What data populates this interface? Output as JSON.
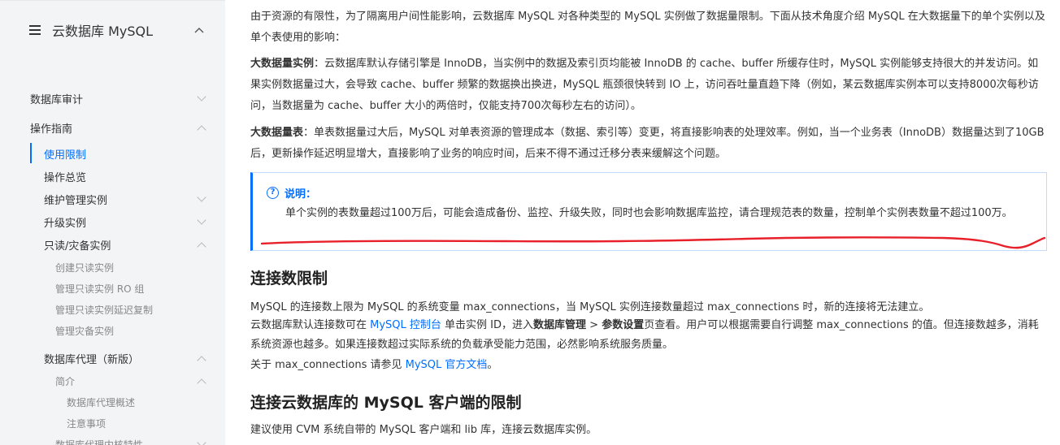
{
  "sidebar": {
    "title": "云数据库 MySQL",
    "items": [
      {
        "label": "数据库审计",
        "arrow": "down"
      },
      {
        "label": "操作指南",
        "arrow": "up"
      },
      {
        "label": "使用限制"
      },
      {
        "label": "操作总览"
      },
      {
        "label": "维护管理实例",
        "arrow": "down"
      },
      {
        "label": "升级实例",
        "arrow": "down"
      },
      {
        "label": "只读/灾备实例",
        "arrow": "up"
      },
      {
        "label": "创建只读实例"
      },
      {
        "label": "管理只读实例 RO 组"
      },
      {
        "label": "管理只读实例延迟复制"
      },
      {
        "label": "管理灾备实例"
      },
      {
        "label": "数据库代理（新版）",
        "arrow": "up"
      },
      {
        "label": "简介",
        "arrow": "up"
      },
      {
        "label": "数据库代理概述"
      },
      {
        "label": "注意事项"
      },
      {
        "label": "数据库代理内核特性",
        "arrow": "down"
      }
    ]
  },
  "content": {
    "intro": "由于资源的有限性，为了隔离用户间性能影响，云数据库 MySQL 对各种类型的 MySQL 实例做了数据量限制。下面从技术角度介绍 MySQL 在大数据量下的单个实例以及单个表使用的影响：",
    "big_instance_label": "大数据量实例",
    "big_instance_text": "：云数据库默认存储引擎是 InnoDB，当实例中的数据及索引页均能被 InnoDB 的 cache、buffer 所缓存住时，MySQL 实例能够支持很大的并发访问。如果实例数据量过大，会导致 cache、buffer 频繁的数据换出换进，MySQL 瓶颈很快转到 IO 上，访问吞吐量直趋下降（例如，某云数据库实例本可以支持8000次每秒访问，当数据量为 cache、buffer 大小的两倍时，仅能支持700次每秒左右的访问）。",
    "big_table_label": "大数据量表",
    "big_table_text": "：单表数据量过大后，MySQL 对单表资源的管理成本（数据、索引等）变更，将直接影响表的处理效率。例如，当一个业务表（InnoDB）数据量达到了10GB后，更新操作延迟明显增大，直接影响了业务的响应时间，后来不得不通过迁移分表来缓解这个问题。",
    "notice_title": "说明：",
    "notice_body": "单个实例的表数量超过100万后，可能会造成备份、监控、升级失败，同时也会影响数据库监控，请合理规范表的数量，控制单个实例表数量不超过100万。",
    "h_conn": "连接数限制",
    "conn_p1": "MySQL 的连接数上限为 MySQL 的系统变量 max_connections，当 MySQL 实例连接数量超过 max_connections 时，新的连接将无法建立。",
    "conn_p2_a": "云数据库默认连接数可在 ",
    "conn_p2_link": "MySQL 控制台",
    "conn_p2_b": " 单击实例 ID，进入",
    "conn_p2_bold1": "数据库管理",
    "conn_p2_c": " > ",
    "conn_p2_bold2": "参数设置",
    "conn_p2_d": "页查看。用户可以根据需要自行调整 max_connections 的值。但连接数越多，消耗系统资源也越多。如果连接数超过实际系统的负载承受能力范围，必然影响系统服务质量。",
    "conn_p3_a": "关于 max_connections 请参见 ",
    "conn_p3_link": "MySQL 官方文档",
    "conn_p3_b": "。",
    "h_client": "连接云数据库的 MySQL 客户端的限制",
    "client_p": "建议使用 CVM 系统自带的 MySQL 客户端和 lib 库，连接云数据库实例。"
  },
  "colors": {
    "accent": "#006eff",
    "annotation": "#e8202a",
    "sidebar_bg": "#f3f4f6"
  }
}
